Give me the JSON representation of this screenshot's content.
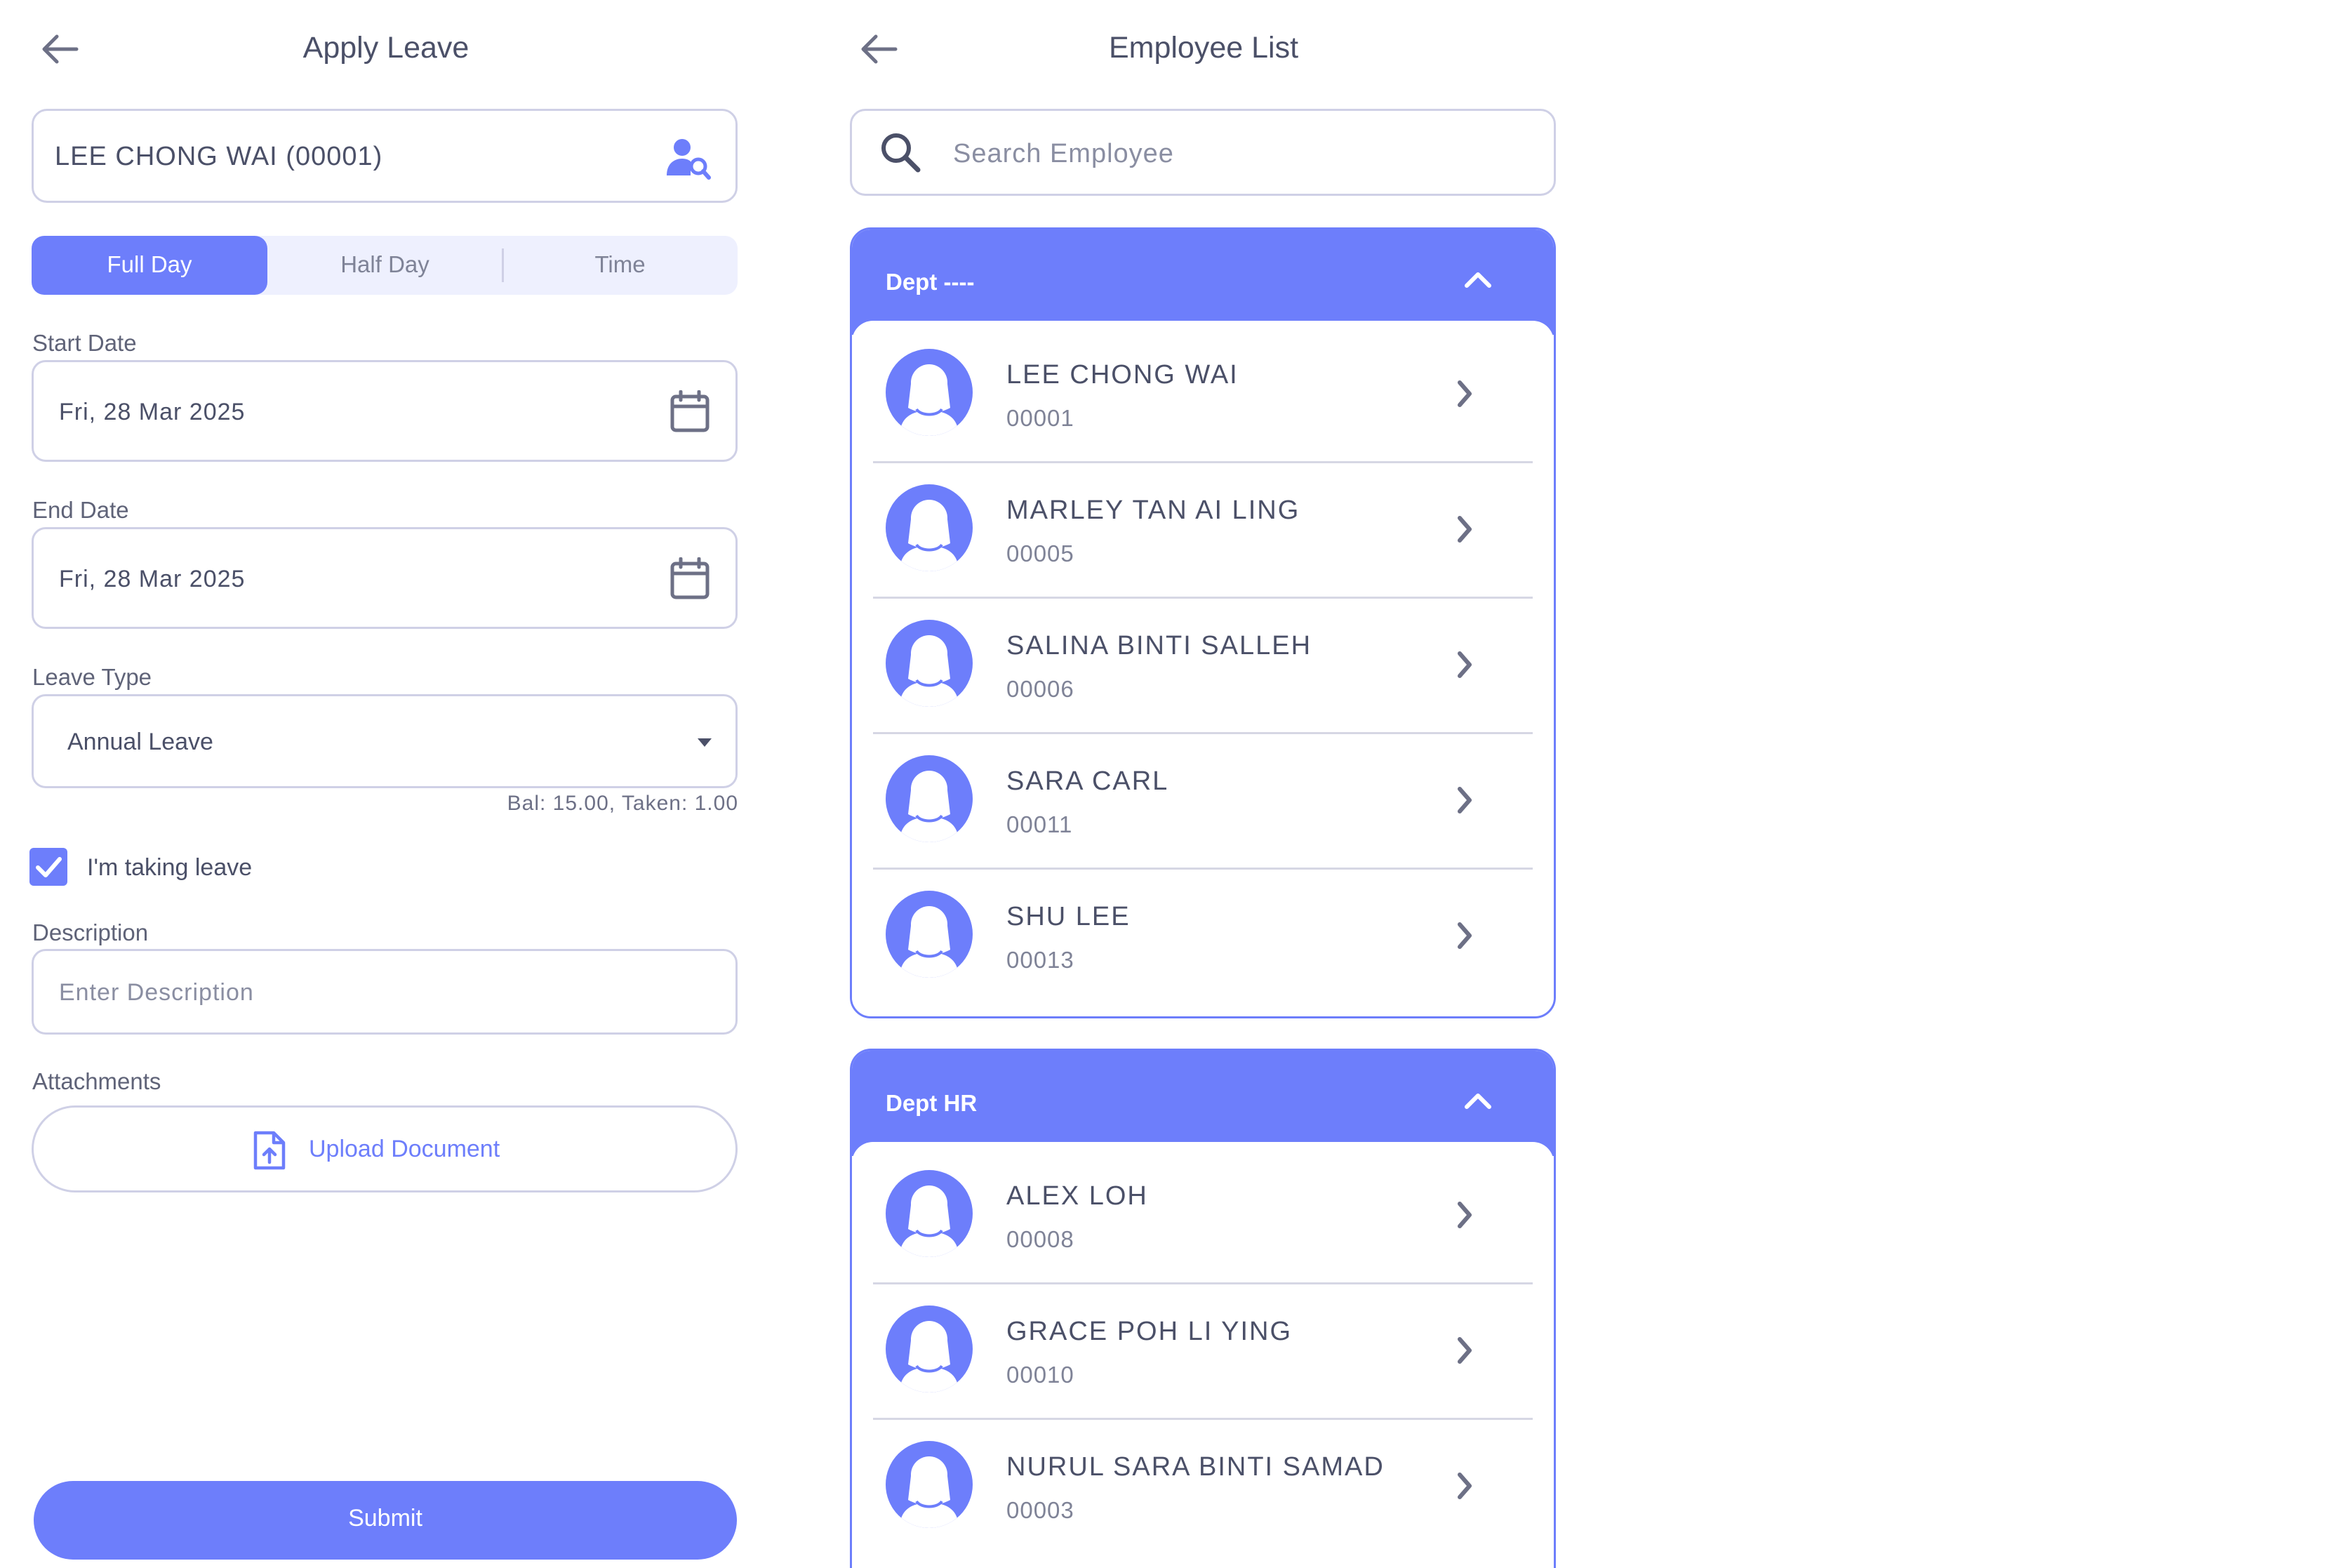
{
  "left": {
    "title": "Apply Leave",
    "employee_value": "LEE CHONG WAI (00001)",
    "segments": [
      "Full Day",
      "Half Day",
      "Time"
    ],
    "active_segment": "Full Day",
    "start_date_label": "Start Date",
    "start_date_value": "Fri, 28 Mar 2025",
    "end_date_label": "End Date",
    "end_date_value": "Fri, 28 Mar 2025",
    "leave_type_label": "Leave Type",
    "leave_type_value": "Annual Leave",
    "balance_text": "Bal: 15.00, Taken: 1.00",
    "checkbox_label": "I'm taking leave",
    "checkbox_checked": true,
    "description_label": "Description",
    "description_placeholder": "Enter Description",
    "attachments_label": "Attachments",
    "upload_label": "Upload Document",
    "submit_label": "Submit"
  },
  "right": {
    "title": "Employee List",
    "search_placeholder": "Search Employee",
    "departments": [
      {
        "name": "Dept ----",
        "employees": [
          {
            "name": "LEE CHONG WAI",
            "code": "00001"
          },
          {
            "name": "MARLEY TAN AI LING",
            "code": "00005"
          },
          {
            "name": "SALINA BINTI SALLEH",
            "code": "00006"
          },
          {
            "name": "SARA CARL",
            "code": "00011"
          },
          {
            "name": "SHU LEE",
            "code": "00013"
          }
        ]
      },
      {
        "name": "Dept HR",
        "employees": [
          {
            "name": "ALEX LOH",
            "code": "00008"
          },
          {
            "name": "GRACE POH LI YING",
            "code": "00010"
          },
          {
            "name": "NURUL SARA BINTI SAMAD",
            "code": "00003"
          }
        ]
      }
    ]
  },
  "colors": {
    "accent": "#6d7efb",
    "text": "#4b5068",
    "muted": "#7f8397",
    "border": "#cfd0e6"
  }
}
